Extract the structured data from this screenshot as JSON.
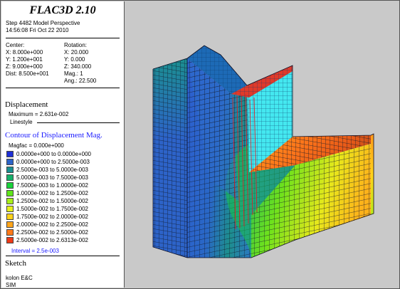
{
  "app": {
    "title": "FLAC3D 2.10"
  },
  "header": {
    "step_line": "Step 4482  Model Perspective",
    "timestamp": "14:56:08 Fri Oct 22 2010"
  },
  "view": {
    "center_label": "Center:",
    "center_x": "X: 8.000e+000",
    "center_y": "Y: 1.200e+001",
    "center_z": "Z: 9.000e+000",
    "dist": "Dist: 8.500e+001",
    "rotation_label": "Rotation:",
    "rot_x": "X:  20.000",
    "rot_y": "Y:   0.000",
    "rot_z": "Z: 340.000",
    "mag": "Mag.:       1",
    "ang": "Ang.:  22.500"
  },
  "displacement": {
    "heading": "Displacement",
    "maximum": "Maximum =  2.631e-002",
    "linestyle": "Linestyle"
  },
  "contour": {
    "heading": "Contour of Displacement Mag.",
    "magfac": "Magfac =  0.000e+000",
    "interval": "Interval =  2.5e-003",
    "items": [
      {
        "label": "0.0000e+000 to  0.0000e+000",
        "color": "#1e2fd6"
      },
      {
        "label": "0.0000e+000 to  2.5000e-003",
        "color": "#2d63c8"
      },
      {
        "label": "2.5000e-003 to  5.0000e-003",
        "color": "#1b8f90"
      },
      {
        "label": "5.0000e-003 to  7.5000e-003",
        "color": "#16b06a"
      },
      {
        "label": "7.5000e-003 to  1.0000e-002",
        "color": "#19d23a"
      },
      {
        "label": "1.0000e-002 to  1.2500e-002",
        "color": "#5fe61b"
      },
      {
        "label": "1.2500e-002 to  1.5000e-002",
        "color": "#a8ef19"
      },
      {
        "label": "1.5000e-002 to  1.7500e-002",
        "color": "#e6f01b"
      },
      {
        "label": "1.7500e-002 to  2.0000e-002",
        "color": "#ffd21a"
      },
      {
        "label": "2.0000e-002 to  2.2500e-002",
        "color": "#ffa51a"
      },
      {
        "label": "2.2500e-002 to  2.5000e-002",
        "color": "#ff7a1a"
      },
      {
        "label": "2.5000e-002 to  2.6313e-002",
        "color": "#f03a18"
      }
    ]
  },
  "sketch": {
    "heading": "Sketch",
    "line1": "kolon E&C",
    "line2": "SIM"
  }
}
